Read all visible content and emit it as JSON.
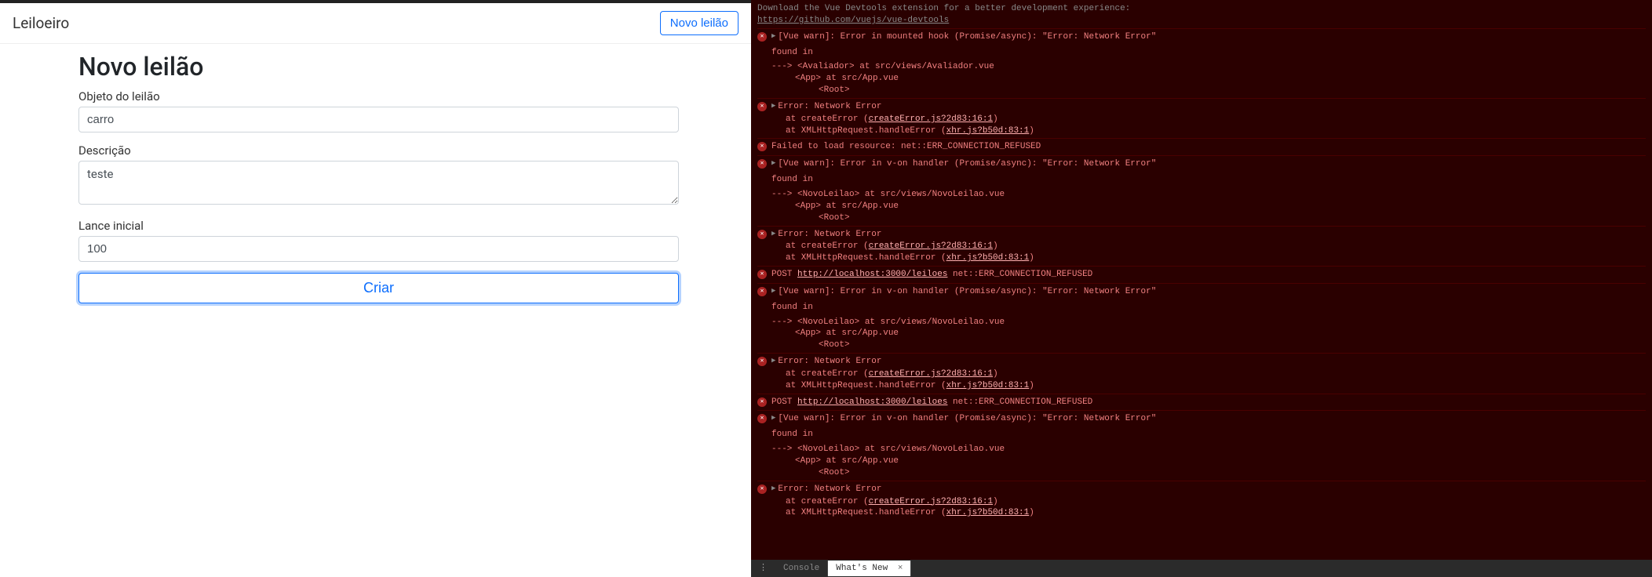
{
  "nav": {
    "brand": "Leiloeiro",
    "new_button": "Novo leilão"
  },
  "page": {
    "title": "Novo leilão",
    "label_objeto": "Objeto do leilão",
    "value_objeto": "carro",
    "label_descricao": "Descrição",
    "value_descricao": "teste",
    "label_lance": "Lance inicial",
    "value_lance": "100",
    "submit_label": "Criar"
  },
  "console": {
    "download_msg": "Download the Vue Devtools extension for a better development experience:",
    "download_link": "https://github.com/vuejs/vue-devtools",
    "warn_mounted": "[Vue warn]: Error in mounted hook (Promise/async): \"Error: Network Error\"",
    "found_in": "found in",
    "trace_avaliador_cmp": "---> <Avaliador> at src/views/Avaliador.vue",
    "trace_app": "<App> at src/App.vue",
    "trace_root": "<Root>",
    "err_network": "Error: Network Error",
    "stack_createError_pre": "at createError (",
    "stack_createError_link": "createError.js?2d83:16:1",
    "stack_xhr_pre": "at XMLHttpRequest.handleError (",
    "stack_xhr_link": "xhr.js?b50d:83:1",
    "stack_close": ")",
    "failed_load": "Failed to load resource: net::ERR_CONNECTION_REFUSED",
    "warn_von": "[Vue warn]: Error in v-on handler (Promise/async): \"Error: Network Error\"",
    "trace_novo_cmp": "---> <NovoLeilao> at src/views/NovoLeilao.vue",
    "post_pre": "POST ",
    "post_url": "http://localhost:3000/leiloes",
    "post_suf": " net::ERR_CONNECTION_REFUSED",
    "bottom_console": "Console",
    "bottom_whatsnew": "What's New",
    "bottom_close": "×"
  }
}
